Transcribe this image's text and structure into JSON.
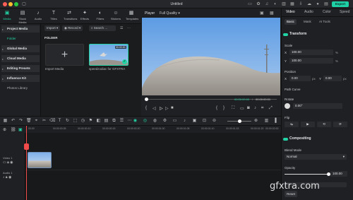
{
  "window": {
    "title": "Untitled",
    "export_label": "Export"
  },
  "media_toolbar": {
    "items": [
      {
        "label": "Media",
        "icon": "media-icon",
        "glyph": "▣"
      },
      {
        "label": "Stock Media",
        "icon": "stock-media-icon",
        "glyph": "▤"
      },
      {
        "label": "Audio",
        "icon": "audio-icon",
        "glyph": "♪"
      },
      {
        "label": "Titles",
        "icon": "titles-icon",
        "glyph": "T"
      },
      {
        "label": "Transitions",
        "icon": "transitions-icon",
        "glyph": "⇄"
      },
      {
        "label": "Effects",
        "icon": "effects-icon",
        "glyph": "✦"
      },
      {
        "label": "Filters",
        "icon": "filters-icon",
        "glyph": "◐"
      },
      {
        "label": "Stickers",
        "icon": "stickers-icon",
        "glyph": "☺"
      },
      {
        "label": "Templates",
        "icon": "templates-icon",
        "glyph": "▦"
      }
    ]
  },
  "sidebar": {
    "items": [
      {
        "label": "Project Media",
        "type": "header"
      },
      {
        "label": "Folder",
        "type": "selected"
      },
      {
        "label": "Global Media",
        "type": "header"
      },
      {
        "label": "Cloud Media",
        "type": "header"
      },
      {
        "label": "Editing Presets",
        "type": "header"
      },
      {
        "label": "Influence Kit",
        "type": "header"
      },
      {
        "label": "Photos Library",
        "type": "plain"
      }
    ]
  },
  "media": {
    "import_label": "Import",
    "record_label": "Record",
    "search_placeholder": "Search ...",
    "folder_label": "FOLDER",
    "import_tile_label": "Import Media",
    "clip_label": "speedzodiac for GFXTRA",
    "clip_duration": "00:00:00"
  },
  "player": {
    "label": "Player",
    "quality": "Full Quality",
    "time_current": "00:00:00:00",
    "time_total": "00:00:00:01"
  },
  "right_panel": {
    "tabs": [
      "Video",
      "Audio",
      "Color",
      "Speed"
    ],
    "subtabs": [
      "Basic",
      "Mask",
      "AI Tools"
    ],
    "transform": "Transform",
    "scale": "Scale",
    "scale_x_label": "X",
    "scale_x": "100.00",
    "scale_y_label": "Y",
    "scale_y": "100.00",
    "percent": "%",
    "position": "Position",
    "pos_x_label": "X",
    "pos_x": "0.00",
    "pos_y_label": "Y",
    "pos_y": "0.00",
    "px": "px",
    "path_curve": "Path Curve",
    "rotate": "Rotate",
    "rotate_value": "0.00°",
    "flip": "Flip",
    "compositing": "Compositing",
    "blend_mode": "Blend Mode",
    "blend_value": "Normal",
    "opacity": "Opacity",
    "opacity_value": "100.00",
    "opacity_level": 1.0,
    "reset_label": "Reset"
  },
  "timeline": {
    "ticks": [
      "00:00",
      "00:00:00:05",
      "00:00:00:10",
      "00:00:00:15",
      "00:00:00:20",
      "00:00:01:00",
      "00:00:01:05",
      "00:00:01:10",
      "00:00:01:15",
      "00:00:01:20",
      "00:00:02:00"
    ],
    "video_track_label": "Video 1",
    "audio_track_label": "Audio 1"
  },
  "colors": {
    "accent": "#22d3a5",
    "playhead": "#f04a4a"
  }
}
